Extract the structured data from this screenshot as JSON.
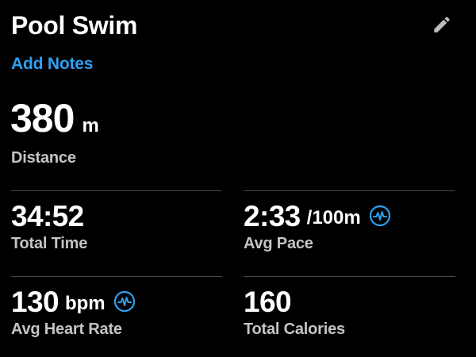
{
  "header": {
    "title": "Pool Swim",
    "add_notes_label": "Add Notes"
  },
  "icons": {
    "edit": "pencil-icon",
    "metric": "heart-rate-wave-icon"
  },
  "colors": {
    "background": "#000000",
    "accent": "#2f9ff2",
    "text": "#ffffff",
    "label": "#c4c4c4",
    "divider": "#4a4a4a"
  },
  "distance": {
    "value": "380",
    "unit": "m",
    "label": "Distance"
  },
  "stats": [
    {
      "value": "34:52",
      "unit": "",
      "label": "Total Time",
      "has_icon": false
    },
    {
      "value": "2:33",
      "unit": "/100m",
      "label": "Avg Pace",
      "has_icon": true
    },
    {
      "value": "130",
      "unit": "bpm",
      "label": "Avg Heart Rate",
      "has_icon": true
    },
    {
      "value": "160",
      "unit": "",
      "label": "Total Calories",
      "has_icon": false
    }
  ]
}
